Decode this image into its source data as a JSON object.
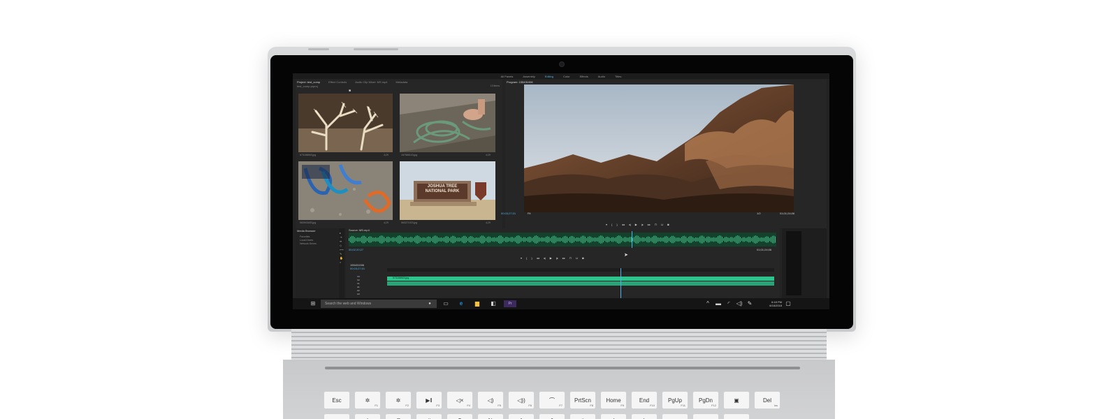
{
  "colors": {
    "accent": "#4fb3e8",
    "waveform": "#2ec28c",
    "panel": "#262626",
    "taskbar": "#151515"
  },
  "workspaces": {
    "tabs": [
      "All Panels",
      "Assembly",
      "Editing",
      "Color",
      "Effects",
      "Audio",
      "Titles"
    ],
    "active": "Editing"
  },
  "project_panel": {
    "tabs": [
      "Project: test_comp",
      "Effect Controls",
      "Audio Clip Mixer: MS.mp4",
      "Metadata"
    ],
    "path": "test_comp.prproj",
    "item_count": "13 items",
    "thumbnails": [
      {
        "name": "573186563.jpg",
        "duration": "4;29",
        "icon": "cholla-cactus-photo"
      },
      {
        "name": "167566143.jpg",
        "duration": "4;29",
        "icon": "climbing-rope-photo"
      },
      {
        "name": "563943483.jpg",
        "duration": "4;29",
        "icon": "carabiners-photo"
      },
      {
        "name": "563271923.jpg",
        "duration": "4;29",
        "icon": "joshua-tree-sign-photo"
      }
    ],
    "sign_text": [
      "JOSHUA TREE",
      "NATIONAL PARK"
    ]
  },
  "program_monitor": {
    "title": "Program: 155431006",
    "timecode_current": "00;03;27;01",
    "fit": "Fit",
    "quality": "1/2",
    "timecode_duration": "01;01;24;06"
  },
  "media_browser": {
    "title": "Media Browser",
    "items": [
      "Favorites",
      "Local Drives",
      "Network Drives"
    ]
  },
  "source_monitor": {
    "title": "Source: MS.mp4",
    "timecode_current": "00;02;20;27",
    "timecode_duration": "01;01;24;06"
  },
  "sequence": {
    "title": "155431006",
    "timecode": "00;03;27;01",
    "tracks": [
      "V3",
      "V2",
      "V1",
      "A1",
      "A2",
      "A3"
    ],
    "clip_name": "573186563.jpg"
  },
  "taskbar": {
    "search_placeholder": "Search the web and Windows",
    "time": "6:18 PM",
    "date": "6/16/2018"
  },
  "keyboard": {
    "row1": [
      {
        "label": "Esc",
        "fn": ""
      },
      {
        "label": "✲",
        "fn": "F1"
      },
      {
        "label": "✲",
        "fn": "F2"
      },
      {
        "label": "▶‖",
        "fn": "F3"
      },
      {
        "label": "◁×",
        "fn": "F4"
      },
      {
        "label": "◁)",
        "fn": "F5"
      },
      {
        "label": "◁))",
        "fn": "F6"
      },
      {
        "label": "⌒",
        "fn": "F7"
      },
      {
        "label": "PrtScn",
        "fn": "F8"
      },
      {
        "label": "Home",
        "fn": "F9"
      },
      {
        "label": "End",
        "fn": "F10"
      },
      {
        "label": "PgUp",
        "fn": "F11"
      },
      {
        "label": "PgDn",
        "fn": "F12"
      },
      {
        "label": "▣",
        "fn": ""
      },
      {
        "label": "Del",
        "fn": "Ins"
      }
    ],
    "row2": [
      "~",
      "!",
      "@",
      "#",
      "$",
      "%",
      "^",
      "&",
      "*",
      "(",
      ")",
      "_",
      "+",
      ""
    ]
  }
}
